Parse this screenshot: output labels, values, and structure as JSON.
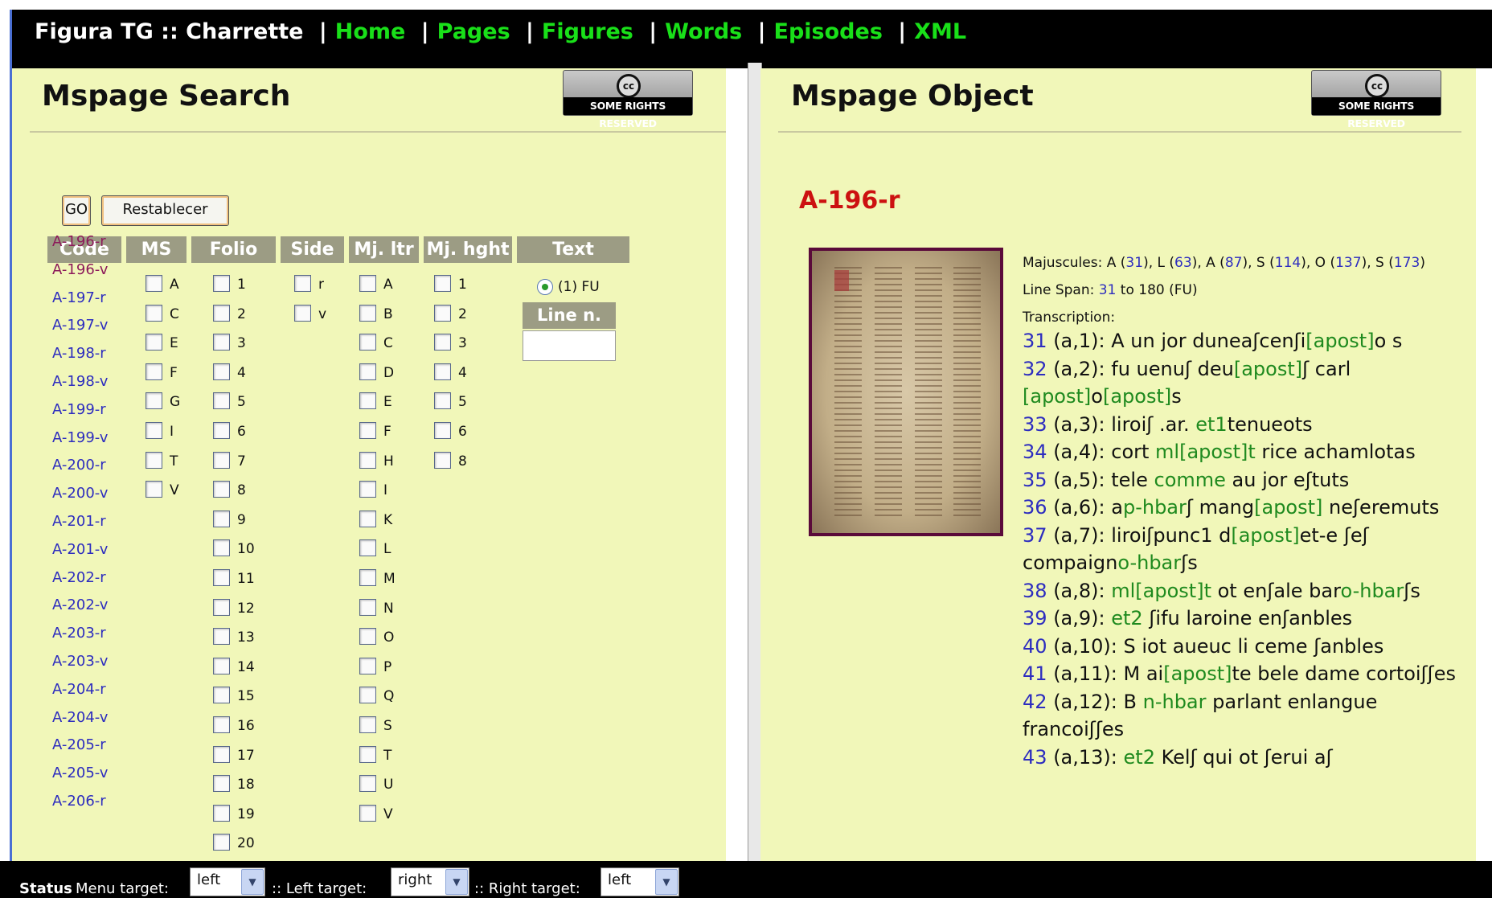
{
  "nav": {
    "site": "Figura TG :: Charrette",
    "links": [
      "Home",
      "Pages",
      "Figures",
      "Words",
      "Episodes",
      "XML"
    ]
  },
  "left": {
    "title": "Mspage Search",
    "cc_label": "SOME RIGHTS RESERVED",
    "go_label": "GO",
    "reset_label": "Restablecer",
    "columns": [
      "Code",
      "MS",
      "Folio",
      "Side",
      "Mj. ltr",
      "Mj. hght",
      "Text"
    ],
    "codes": [
      "A-196-r",
      "A-196-v",
      "A-197-r",
      "A-197-v",
      "A-198-r",
      "A-198-v",
      "A-199-r",
      "A-199-v",
      "A-200-r",
      "A-200-v",
      "A-201-r",
      "A-201-v",
      "A-202-r",
      "A-202-v",
      "A-203-r",
      "A-203-v",
      "A-204-r",
      "A-204-v",
      "A-205-r",
      "A-205-v",
      "A-206-r"
    ],
    "ms": [
      "A",
      "C",
      "E",
      "F",
      "G",
      "I",
      "T",
      "V"
    ],
    "folio": [
      "1",
      "2",
      "3",
      "4",
      "5",
      "6",
      "7",
      "8",
      "9",
      "10",
      "11",
      "12",
      "13",
      "14",
      "15",
      "16",
      "17",
      "18",
      "19",
      "20"
    ],
    "side": [
      "r",
      "v"
    ],
    "mj_ltr": [
      "A",
      "B",
      "C",
      "D",
      "E",
      "F",
      "H",
      "I",
      "K",
      "L",
      "M",
      "N",
      "O",
      "P",
      "Q",
      "S",
      "T",
      "U",
      "V"
    ],
    "mj_hght": [
      "1",
      "2",
      "3",
      "4",
      "5",
      "6",
      "8"
    ],
    "text_option": "(1) FU",
    "line_n_label": "Line n.",
    "line_n_value": ""
  },
  "right": {
    "title": "Mspage Object",
    "cc_label": "SOME RIGHTS RESERVED",
    "page_code": "A-196-r",
    "majuscules_label": "Majuscules:",
    "majuscules": [
      {
        "l": "A",
        "n": "31"
      },
      {
        "l": "L",
        "n": "63"
      },
      {
        "l": "A",
        "n": "87"
      },
      {
        "l": "S",
        "n": "114"
      },
      {
        "l": "O",
        "n": "137"
      },
      {
        "l": "S",
        "n": "173"
      }
    ],
    "line_span_label": "Line Span:",
    "line_span_from": "31",
    "line_span_to": "180",
    "line_span_suffix": "(FU)",
    "transcription_label": "Transcription:",
    "lines": [
      {
        "n": "31",
        "pos": "(a,1):",
        "parts": [
          [
            "t",
            "A un jor dunea"
          ],
          [
            "t",
            "ʃcenʃi"
          ],
          [
            "g",
            "[apost]"
          ],
          [
            "t",
            "o s"
          ]
        ]
      },
      {
        "n": "32",
        "pos": "(a,2):",
        "parts": [
          [
            "t",
            "fu uenuʃ deu"
          ],
          [
            "g",
            "[apost]"
          ],
          [
            "t",
            "ʃ carl "
          ],
          [
            "g",
            "[apost]"
          ],
          [
            "t",
            "o"
          ],
          [
            "g",
            "[apost]"
          ],
          [
            "t",
            "s"
          ]
        ]
      },
      {
        "n": "33",
        "pos": "(a,3):",
        "parts": [
          [
            "t",
            "liroiʃ .ar. "
          ],
          [
            "g",
            "et1"
          ],
          [
            "t",
            "tenueots"
          ]
        ]
      },
      {
        "n": "34",
        "pos": "(a,4):",
        "parts": [
          [
            "t",
            "cort "
          ],
          [
            "g",
            "ml[apost]t"
          ],
          [
            "t",
            " rice achamlotas"
          ]
        ]
      },
      {
        "n": "35",
        "pos": "(a,5):",
        "parts": [
          [
            "t",
            "tele "
          ],
          [
            "g",
            "comme"
          ],
          [
            "t",
            " au jor eʃtuts"
          ]
        ]
      },
      {
        "n": "36",
        "pos": "(a,6):",
        "parts": [
          [
            "t",
            "a"
          ],
          [
            "g",
            "p-hbar"
          ],
          [
            "t",
            "ʃ mang"
          ],
          [
            "g",
            "[apost]"
          ],
          [
            "t",
            " neʃeremuts"
          ]
        ]
      },
      {
        "n": "37",
        "pos": "(a,7):",
        "parts": [
          [
            "t",
            "liroiʃpunc1 d"
          ],
          [
            "g",
            "[apost]"
          ],
          [
            "t",
            "et-e ʃeʃ compaign"
          ],
          [
            "g",
            "o-hbar"
          ],
          [
            "t",
            "ʃs"
          ]
        ]
      },
      {
        "n": "38",
        "pos": "(a,8):",
        "parts": [
          [
            "g",
            "ml[apost]t"
          ],
          [
            "t",
            " ot enʃale bar"
          ],
          [
            "g",
            "o-hbar"
          ],
          [
            "t",
            "ʃs"
          ]
        ]
      },
      {
        "n": "39",
        "pos": "(a,9):",
        "parts": [
          [
            "g",
            "et2"
          ],
          [
            "t",
            " ʃifu laroine enʃanbles"
          ]
        ]
      },
      {
        "n": "40",
        "pos": "(a,10):",
        "parts": [
          [
            "t",
            "S iot aueuc li ceme ʃanbles"
          ]
        ]
      },
      {
        "n": "41",
        "pos": "(a,11):",
        "parts": [
          [
            "t",
            "M ai"
          ],
          [
            "g",
            "[apost]"
          ],
          [
            "t",
            "te bele dame cortoiʃʃes"
          ]
        ]
      },
      {
        "n": "42",
        "pos": "(a,12):",
        "parts": [
          [
            "t",
            "B "
          ],
          [
            "g",
            "n-hbar"
          ],
          [
            "t",
            " parlant enlangue francoiʃʃes"
          ]
        ]
      },
      {
        "n": "43",
        "pos": "(a,13):",
        "parts": [
          [
            "g",
            "et2"
          ],
          [
            "t",
            " Kelʃ qui ot ʃerui aʃ"
          ]
        ]
      }
    ]
  },
  "status": {
    "title": "Status",
    "menu_label": "Menu target:",
    "menu_value": "left",
    "left_label": ":: Left target:",
    "left_value": "right",
    "right_label": ":: Right target:",
    "right_value": "left"
  }
}
